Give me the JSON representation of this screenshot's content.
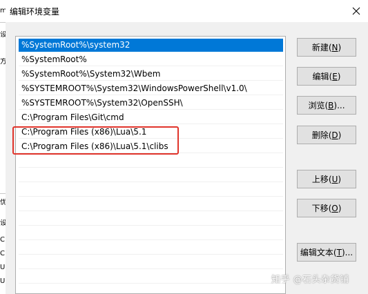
{
  "background_window": {
    "chars": [
      "m",
      "设",
      "方",
      "",
      "",
      "",
      "",
      "",
      "",
      "",
      "",
      "优",
      "设",
      "C",
      "C",
      "U",
      "U",
      "V"
    ]
  },
  "dialog": {
    "title": "编辑环境变量",
    "close_label": "×"
  },
  "path_list": {
    "items": [
      "%SystemRoot%\\system32",
      "%SystemRoot%",
      "%SystemRoot%\\System32\\Wbem",
      "%SYSTEMROOT%\\System32\\WindowsPowerShell\\v1.0\\",
      "%SYSTEMROOT%\\System32\\OpenSSH\\",
      "C:\\Program Files\\Git\\cmd",
      "C:\\Program Files (x86)\\Lua\\5.1",
      "C:\\Program Files (x86)\\Lua\\5.1\\clibs"
    ],
    "selected_index": 0
  },
  "buttons": {
    "new": {
      "label": "新建(",
      "key": "N",
      "tail": ")"
    },
    "edit": {
      "label": "编辑(",
      "key": "E",
      "tail": ")"
    },
    "browse": {
      "label": "浏览(",
      "key": "B",
      "tail": ")..."
    },
    "delete": {
      "label": "删除(",
      "key": "D",
      "tail": ")"
    },
    "move_up": {
      "label": "上移(",
      "key": "U",
      "tail": ")"
    },
    "move_down": {
      "label": "下移(",
      "key": "O",
      "tail": ")"
    },
    "edit_text": {
      "label": "编辑文本(",
      "key": "T",
      "tail": ")..."
    }
  },
  "watermark": "知乎 @石头杂货铺",
  "colors": {
    "selection": "#0078d7",
    "highlight_box": "#e0332a",
    "button_face": "#e1e1e1"
  }
}
